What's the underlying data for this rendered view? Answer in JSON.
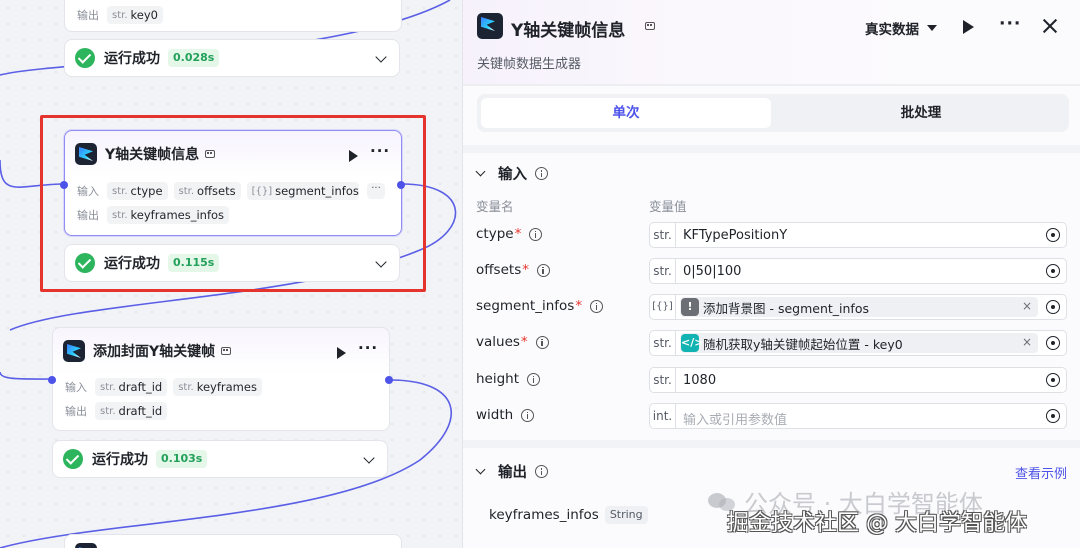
{
  "canvas": {
    "top_node": {
      "output_label": "输出",
      "outputs": [
        {
          "type": "str.",
          "name": "key0"
        }
      ],
      "status": "运行成功",
      "time": "0.028s"
    },
    "selected_node": {
      "title": "Y轴关键帧信息",
      "input_label": "输入",
      "inputs": [
        {
          "type": "str.",
          "name": "ctype"
        },
        {
          "type": "str.",
          "name": "offsets"
        },
        {
          "type": "[{}]",
          "name": "segment_infos"
        }
      ],
      "output_label": "输出",
      "outputs": [
        {
          "type": "str.",
          "name": "keyframes_infos"
        }
      ],
      "status": "运行成功",
      "time": "0.115s"
    },
    "cover_node": {
      "title": "添加封面Y轴关键帧",
      "input_label": "输入",
      "inputs": [
        {
          "type": "str.",
          "name": "draft_id"
        },
        {
          "type": "str.",
          "name": "keyframes"
        }
      ],
      "output_label": "输出",
      "outputs": [
        {
          "type": "str.",
          "name": "draft_id"
        }
      ],
      "status": "运行成功",
      "time": "0.103s"
    }
  },
  "panel": {
    "title": "Y轴关键帧信息",
    "subtitle": "关键帧数据生成器",
    "data_mode": "真实数据",
    "tabs": [
      {
        "label": "单次",
        "active": true
      },
      {
        "label": "批处理",
        "active": false
      }
    ],
    "input_section": {
      "title": "输入",
      "col_name": "变量名",
      "col_value": "变量值",
      "params": [
        {
          "name": "ctype",
          "required": true,
          "type": "str.",
          "kind": "text",
          "value": "KFTypePositionY"
        },
        {
          "name": "offsets",
          "required": true,
          "type": "str.",
          "kind": "text",
          "value": "0|50|100"
        },
        {
          "name": "segment_infos",
          "required": true,
          "type": "[{}]",
          "kind": "ref",
          "ref_icon": "warning",
          "value": "添加背景图 - segment_infos"
        },
        {
          "name": "values",
          "required": true,
          "type": "str.",
          "kind": "ref",
          "ref_icon": "code",
          "value": "随机获取y轴关键帧起始位置 - key0"
        },
        {
          "name": "height",
          "required": false,
          "type": "str.",
          "kind": "text",
          "value": "1080"
        },
        {
          "name": "width",
          "required": false,
          "type": "int.",
          "kind": "placeholder",
          "value": "输入或引用参数值"
        }
      ]
    },
    "output_section": {
      "title": "输出",
      "view_example": "查看示例",
      "outputs": [
        {
          "name": "keyframes_infos",
          "type": "String"
        }
      ]
    }
  },
  "watermarks": {
    "line1": "公众号 · 大白学智能体",
    "line2": "掘金技术社区 @ 大白学智能体"
  },
  "colors": {
    "accent": "#4d53e8",
    "success": "#2db55d",
    "highlight_box": "#e5342d",
    "required_mark": "#e5342d"
  }
}
